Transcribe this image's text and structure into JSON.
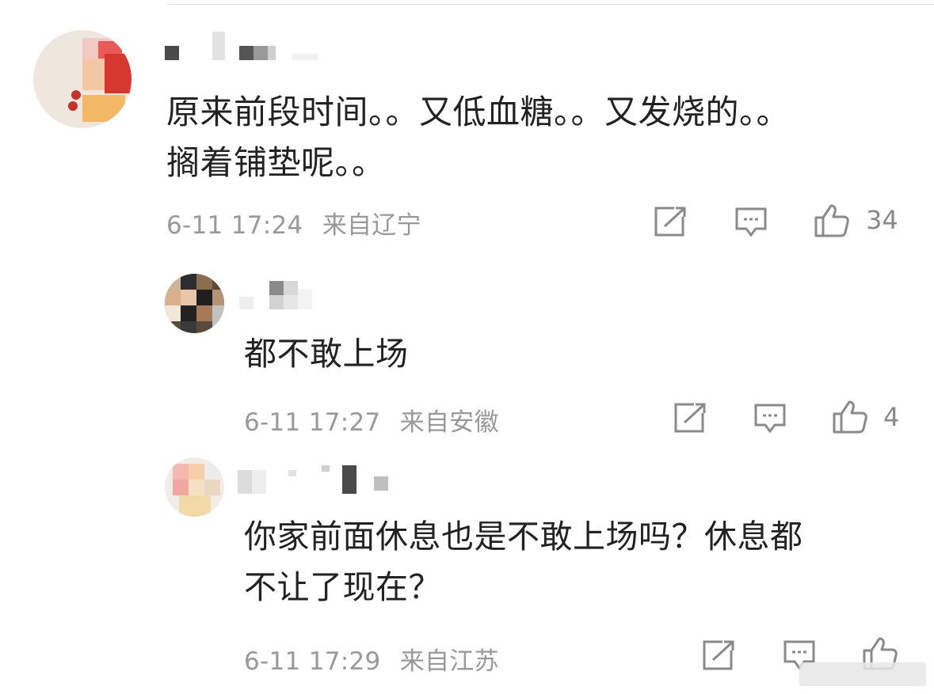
{
  "comments": [
    {
      "text_lines": [
        "原来前段时间。。又低血糖。。又发烧的。。",
        "搁着铺垫呢。。"
      ],
      "time": "6-11 17:24",
      "location": "来自辽宁",
      "likes": "34"
    },
    {
      "text_lines": [
        "都不敢上场"
      ],
      "time": "6-11 17:27",
      "location": "来自安徽",
      "likes": "4"
    },
    {
      "text_lines": [
        "你家前面休息也是不敢上场吗？休息都",
        "不让了现在？"
      ],
      "time": "6-11 17:29",
      "location": "来自江苏",
      "likes": ""
    }
  ],
  "icons": {
    "share": "share-icon",
    "comment": "comment-icon",
    "like": "like-icon"
  },
  "colors": {
    "text": "#222222",
    "meta": "#999999",
    "icon": "#8a8a8a"
  }
}
